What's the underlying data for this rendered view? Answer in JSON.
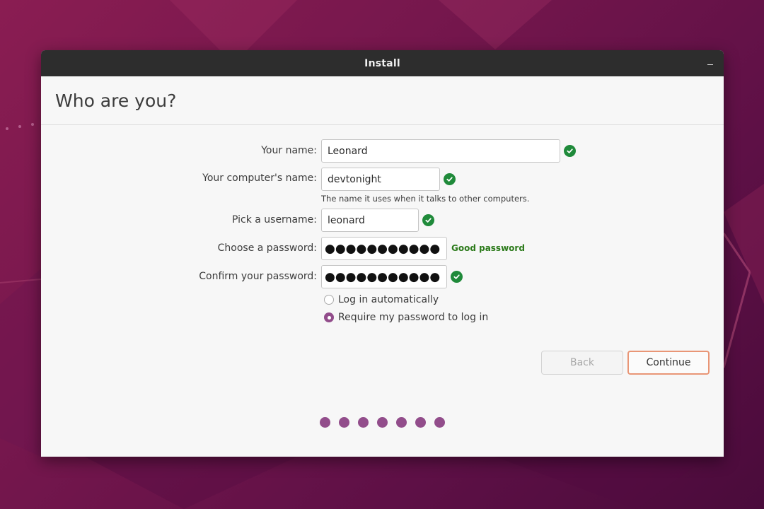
{
  "window": {
    "title": "Install"
  },
  "page": {
    "heading": "Who are you?"
  },
  "form": {
    "name": {
      "label": "Your name:",
      "value": "Leonard"
    },
    "computer": {
      "label": "Your computer's name:",
      "value": "devtonight",
      "hint": "The name it uses when it talks to other computers."
    },
    "username": {
      "label": "Pick a username:",
      "value": "leonard"
    },
    "password": {
      "label": "Choose a password:",
      "value": "●●●●●●●●●●●●●",
      "strength": "Good password"
    },
    "confirm": {
      "label": "Confirm your password:",
      "value": "●●●●●●●●●●●●●"
    },
    "login_options": [
      {
        "label": "Log in automatically",
        "checked": false
      },
      {
        "label": "Require my password to log in",
        "checked": true
      }
    ]
  },
  "buttons": {
    "back": "Back",
    "continue": "Continue"
  },
  "progress": {
    "total_steps": 7
  },
  "colors": {
    "accent": "#924d8b",
    "valid": "#1f8a3a",
    "strength_text": "#2b7a1a",
    "continue_border": "#e99676",
    "titlebar": "#2d2d2d"
  },
  "icons": {
    "valid": "check-circle-icon",
    "minimize": "minimize-icon"
  }
}
